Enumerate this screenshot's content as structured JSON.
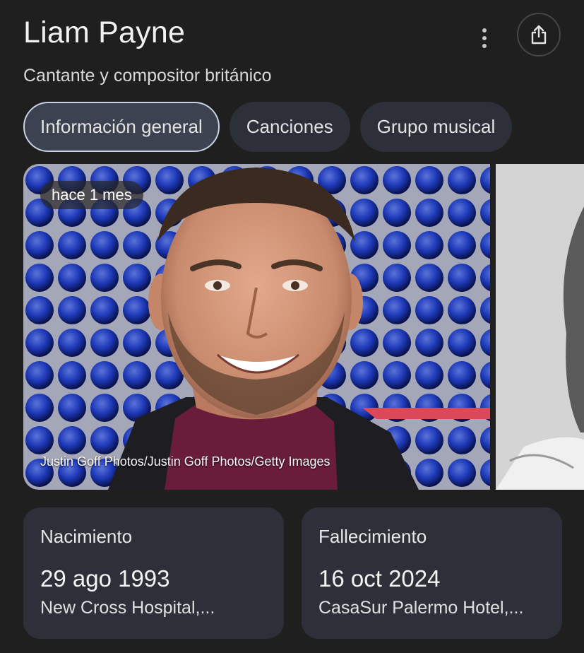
{
  "header": {
    "title": "Liam Payne",
    "subtitle": "Cantante y compositor británico",
    "more_icon": "more-vert-icon",
    "share_icon": "share-icon"
  },
  "tabs": [
    {
      "label": "Información general",
      "active": true
    },
    {
      "label": "Canciones",
      "active": false
    },
    {
      "label": "Grupo musical",
      "active": false
    }
  ],
  "media": {
    "time_label": "hace 1 mes",
    "credit": "Justin Goff Photos/Justin Goff Photos/Getty Images"
  },
  "facts": [
    {
      "label": "Nacimiento",
      "value": "29 ago 1993",
      "detail": "New Cross Hospital,..."
    },
    {
      "label": "Fallecimiento",
      "value": "16 oct 2024",
      "detail": "CasaSur Palermo Hotel,..."
    }
  ],
  "colors": {
    "background": "#1f1f1f",
    "card": "#2d3039",
    "active_tab_border": "#c9d1e2",
    "sequin_blue": "#2f5cff"
  }
}
